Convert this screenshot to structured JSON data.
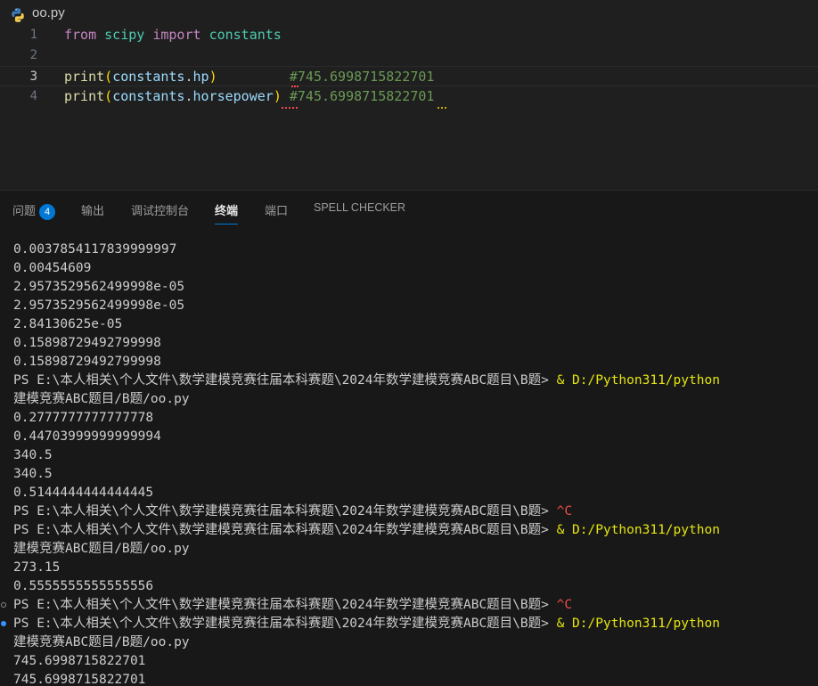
{
  "editor": {
    "file_name": "oo.py",
    "lines": [
      {
        "num": "1",
        "t1": "from",
        "t2": " ",
        "t3": "scipy",
        "t4": " ",
        "t5": "import",
        "t6": " ",
        "t7": "constants"
      },
      {
        "num": "2"
      },
      {
        "num": "3",
        "fn": "print",
        "po": "(",
        "obj": "constants",
        "dot": ".",
        "attr": "hp",
        "pc": ")",
        "pad": "         ",
        "comment": "#745.6998715822701"
      },
      {
        "num": "4",
        "fn": "print",
        "po": "(",
        "obj": "constants",
        "dot": ".",
        "attr": "horsepower",
        "pc": ")",
        "pad": " ",
        "comment": "#745.6998715822701"
      }
    ]
  },
  "panel": {
    "tabs": [
      {
        "label": "问题",
        "badge": "4"
      },
      {
        "label": "输出"
      },
      {
        "label": "调试控制台"
      },
      {
        "label": "终端",
        "active": true
      },
      {
        "label": "端口"
      },
      {
        "label": "SPELL CHECKER"
      }
    ]
  },
  "terminal": {
    "lines": [
      {
        "text": "0.0037854117839999997"
      },
      {
        "text": "0.00454609"
      },
      {
        "text": "2.9573529562499998e-05"
      },
      {
        "text": "2.9573529562499998e-05"
      },
      {
        "text": "2.84130625e-05"
      },
      {
        "text": "0.15898729492799998"
      },
      {
        "text": "0.15898729492799998"
      },
      {
        "text": "PS E:\\本人相关\\个人文件\\数学建模竞赛往届本科赛题\\2024年数学建模竞赛ABC题目\\B题> ",
        "cmd": "& D:/Python311/python"
      },
      {
        "text": "建模竞赛ABC题目/B题/oo.py"
      },
      {
        "text": "0.2777777777777778"
      },
      {
        "text": "0.44703999999999994"
      },
      {
        "text": "340.5"
      },
      {
        "text": "340.5"
      },
      {
        "text": "0.5144444444444445"
      },
      {
        "text": "PS E:\\本人相关\\个人文件\\数学建模竞赛往届本科赛题\\2024年数学建模竞赛ABC题目\\B题> ",
        "ctrl": "^C"
      },
      {
        "text": "PS E:\\本人相关\\个人文件\\数学建模竞赛往届本科赛题\\2024年数学建模竞赛ABC题目\\B题> ",
        "cmd": "& D:/Python311/python"
      },
      {
        "text": "建模竞赛ABC题目/B题/oo.py"
      },
      {
        "text": "273.15"
      },
      {
        "text": "0.5555555555555556"
      },
      {
        "text": "PS E:\\本人相关\\个人文件\\数学建模竞赛往届本科赛题\\2024年数学建模竞赛ABC题目\\B题> ",
        "ctrl": "^C",
        "deco": "hollow"
      },
      {
        "text": "PS E:\\本人相关\\个人文件\\数学建模竞赛往届本科赛题\\2024年数学建模竞赛ABC题目\\B题> ",
        "cmd": "& D:/Python311/python",
        "deco": "filled"
      },
      {
        "text": "建模竞赛ABC题目/B题/oo.py"
      },
      {
        "text": "745.6998715822701"
      },
      {
        "text": "745.6998715822701"
      }
    ]
  }
}
